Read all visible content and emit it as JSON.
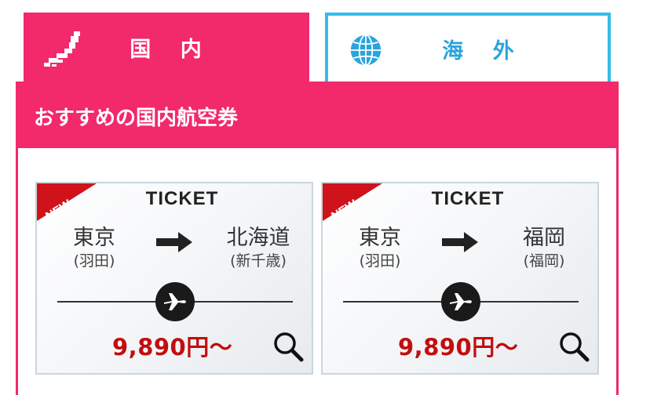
{
  "tabs": [
    {
      "label": "国 内",
      "icon": "japan-map-icon",
      "active": true
    },
    {
      "label": "海 外",
      "icon": "globe-icon",
      "active": false
    }
  ],
  "section": {
    "title": "おすすめの国内航空券"
  },
  "cards": [
    {
      "badge": "NEW",
      "heading": "TICKET",
      "from": {
        "city": "東京",
        "airport": "(羽田)"
      },
      "to": {
        "city": "北海道",
        "airport": "(新千歳)"
      },
      "price": "9,890円～"
    },
    {
      "badge": "NEW",
      "heading": "TICKET",
      "from": {
        "city": "東京",
        "airport": "(羽田)"
      },
      "to": {
        "city": "福岡",
        "airport": "(福岡)"
      },
      "price": "9,890円～"
    }
  ],
  "colors": {
    "accent": "#f2296b",
    "overseas": "#33bde8",
    "price": "#c20e0e"
  }
}
